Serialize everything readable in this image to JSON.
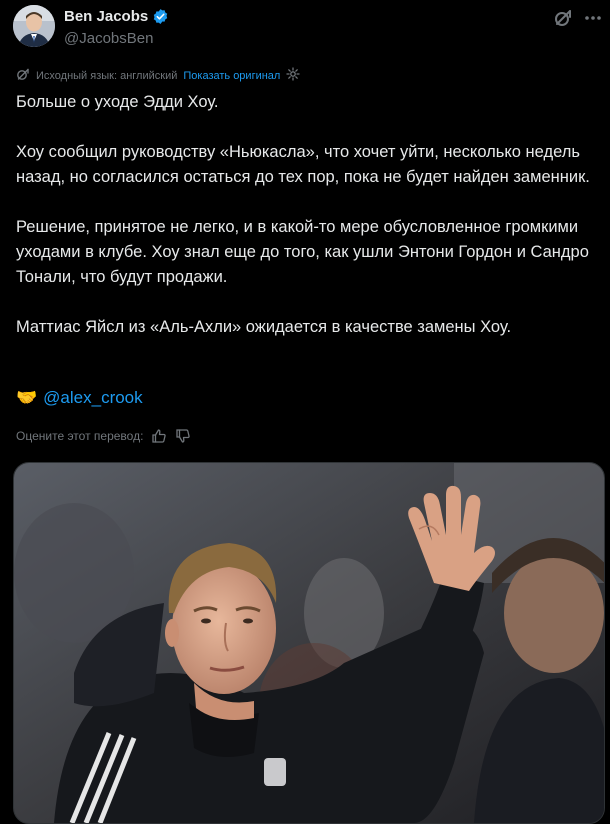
{
  "author": {
    "display_name": "Ben Jacobs",
    "handle": "@JacobsBen",
    "verified": true
  },
  "icons": {
    "grok": "grok-icon",
    "more": "more-icon",
    "verified": "verified-badge-icon",
    "translate": "translate-icon",
    "settings": "gear-icon",
    "thumbs_up": "thumbs-up-icon",
    "thumbs_down": "thumbs-down-icon",
    "handshake": "handshake-emoji"
  },
  "translation": {
    "source_label": "Исходный язык: английский",
    "show_original": "Показать оригинал"
  },
  "tweet": {
    "paragraphs": [
      "Больше о уходе Эдди Хоу.",
      "Хоу сообщил руководству «Ньюкасла», что хочет уйти, несколько недель назад, но согласился остаться до тех пор, пока не будет найден заменник.",
      "Решение, принятое не легко, и в какой-то мере обусловленное громкими уходами в клубе. Хоу знал еще до того, как ушли Энтони Гордон и Сандро Тонали, что будут продажи.",
      "Маттиас Яйсл из «Аль-Ахли» ожидается в качестве замены Хоу."
    ],
    "mention_emoji": "🤝",
    "mention": "@alex_crook"
  },
  "rating": {
    "label": "Оцените этот перевод:"
  },
  "media": {
    "description_icon": "photo"
  },
  "colors": {
    "background": "#000000",
    "text": "#e7e9ea",
    "secondary": "#71767b",
    "accent": "#1d9bf0",
    "border": "#2f3336"
  }
}
